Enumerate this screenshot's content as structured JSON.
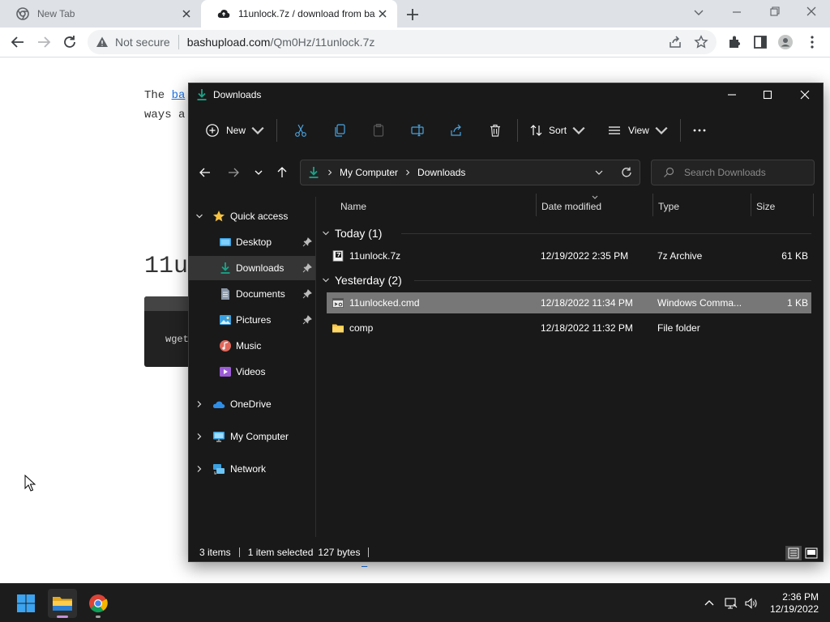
{
  "browser": {
    "tabs": [
      {
        "title": "New Tab",
        "active": false
      },
      {
        "title": "11unlock.7z / download from ba",
        "active": true
      }
    ],
    "omnibox": {
      "security": "Not secure",
      "host": "bashupload.com",
      "path": "/Qm0Hz/11unlock.7z"
    }
  },
  "page": {
    "line1_prefix": "The ",
    "line1_link": "ba",
    "line2": "ways a",
    "heading": "11u",
    "code": "wget",
    "footer_links": [
      "",
      ""
    ]
  },
  "explorer": {
    "title": "Downloads",
    "commands": {
      "new": "New",
      "sort": "Sort",
      "view": "View"
    },
    "address": {
      "crumbs": [
        "My Computer",
        "Downloads"
      ]
    },
    "search_placeholder": "Search Downloads",
    "nav": {
      "quick_access": "Quick access",
      "items": [
        "Desktop",
        "Downloads",
        "Documents",
        "Pictures",
        "Music",
        "Videos"
      ],
      "onedrive": "OneDrive",
      "my_computer": "My Computer",
      "network": "Network"
    },
    "columns": {
      "name": "Name",
      "date": "Date modified",
      "type": "Type",
      "size": "Size"
    },
    "groups": [
      {
        "label": "Today (1)",
        "files": [
          {
            "name": "11unlock.7z",
            "date": "12/19/2022 2:35 PM",
            "type": "7z Archive",
            "size": "61 KB"
          }
        ]
      },
      {
        "label": "Yesterday (2)",
        "files": [
          {
            "name": "11unlocked.cmd",
            "date": "12/18/2022 11:34 PM",
            "type": "Windows Comma...",
            "size": "1 KB"
          },
          {
            "name": "comp",
            "date": "12/18/2022 11:32 PM",
            "type": "File folder",
            "size": ""
          }
        ]
      }
    ],
    "status": {
      "items": "3 items",
      "selected": "1 item selected",
      "bytes": "127 bytes"
    }
  },
  "taskbar": {
    "time": "2:36 PM",
    "date": "12/19/2022"
  },
  "colors": {
    "accent_green": "#17a589",
    "folder_yellow": "#f6c342",
    "selection": "#777777"
  }
}
